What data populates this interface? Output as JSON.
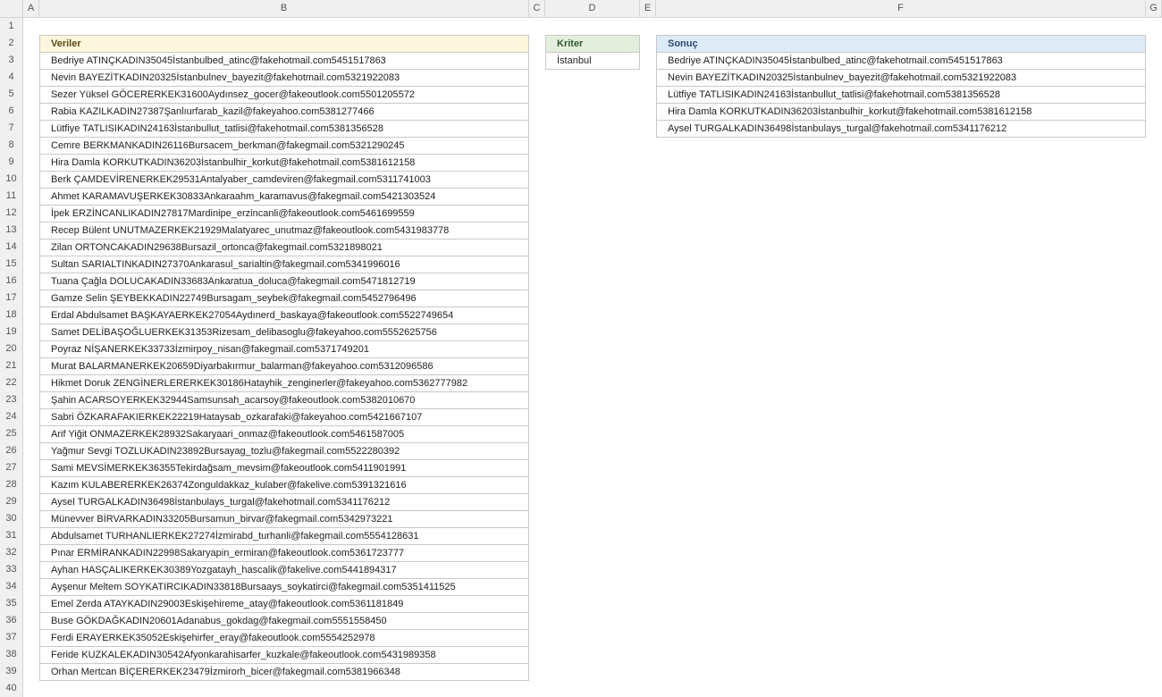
{
  "columns": [
    "A",
    "B",
    "C",
    "D",
    "E",
    "F",
    "G"
  ],
  "rows": [
    "1",
    "2",
    "3",
    "4",
    "5",
    "6",
    "7",
    "8",
    "9",
    "10",
    "11",
    "12",
    "13",
    "14",
    "15",
    "16",
    "17",
    "18",
    "19",
    "20",
    "21",
    "22",
    "23",
    "24",
    "25",
    "26",
    "27",
    "28",
    "29",
    "30",
    "31",
    "32",
    "33",
    "34",
    "35",
    "36",
    "37",
    "38",
    "39",
    "40"
  ],
  "veriler": {
    "header": "Veriler",
    "items": [
      "Bedriye ATINÇKADIN35045İstanbulbed_atinc@fakehotmail.com5451517863",
      "Nevin BAYEZİTKADIN20325İstanbulnev_bayezit@fakehotmail.com5321922083",
      "Sezer Yüksel GÖCERERKEK31600Aydınsez_gocer@fakeoutlook.com5501205572",
      "Rabia KAZILKADIN27387Şanlıurfarab_kazil@fakeyahoo.com5381277466",
      "Lütfiye TATLISIKADIN24163İstanbullut_tatlisi@fakehotmail.com5381356528",
      "Cemre BERKMANKADIN26116Bursacem_berkman@fakegmail.com5321290245",
      "Hira Damla KORKUTKADIN36203İstanbulhir_korkut@fakehotmail.com5381612158",
      "Berk ÇAMDEVİRENERKEK29531Antalyaber_camdeviren@fakegmail.com5311741003",
      "Ahmet KARAMAVUŞERKEK30833Ankaraahm_karamavus@fakegmail.com5421303524",
      "İpek ERZİNCANLIKADIN27817Mardinipe_erzincanli@fakeoutlook.com5461699559",
      "Recep Bülent UNUTMAZERKEK21929Malatyarec_unutmaz@fakeoutlook.com5431983778",
      "Zilan ORTONCAKADIN29638Bursazil_ortonca@fakegmail.com5321898021",
      "Sultan SARIALTINKADIN27370Ankarasul_sarialtin@fakegmail.com5341996016",
      "Tuana Çağla DOLUCAKADIN33683Ankaratua_doluca@fakegmail.com5471812719",
      "Gamze Selin ŞEYBEKKADIN22749Bursagam_seybek@fakegmail.com5452796496",
      "Erdal Abdulsamet BAŞKAYAERKEK27054Aydınerd_baskaya@fakeoutlook.com5522749654",
      "Samet DELİBAŞOĞLUERKEK31353Rizesam_delibasoglu@fakeyahoo.com5552625756",
      "Poyraz NİŞANERKEK33733İzmirpoy_nisan@fakegmail.com5371749201",
      "Murat BALARMANERKEK20659Diyarbakırmur_balarman@fakeyahoo.com5312096586",
      "Hikmet Doruk ZENGİNERLERERKEK30186Hatayhik_zenginerler@fakeyahoo.com5362777982",
      "Şahin ACARSOYERKEK32944Samsunsah_acarsoy@fakeoutlook.com5382010670",
      "Sabri ÖZKARAFAKIERKEK22219Hataysab_ozkarafaki@fakeyahoo.com5421667107",
      "Arif Yiğit ONMAZERKEK28932Sakaryaari_onmaz@fakeoutlook.com5461587005",
      "Yağmur Sevgi TOZLUKADIN23892Bursayag_tozlu@fakegmail.com5522280392",
      "Sami MEVSİMERKEK36355Tekirdağsam_mevsim@fakeoutlook.com5411901991",
      "Kazım KULABERERKEK26374Zonguldakkaz_kulaber@fakelive.com5391321616",
      "Aysel TURGALKADIN36498İstanbulays_turgal@fakehotmail.com5341176212",
      "Münevver BİRVARKADIN33205Bursamun_birvar@fakegmail.com5342973221",
      "Abdulsamet TURHANLIERKEK27274İzmirabd_turhanli@fakegmail.com5554128631",
      "Pınar ERMİRANKADIN22998Sakaryapin_ermiran@fakeoutlook.com5361723777",
      "Ayhan HASÇALIKERKEK30389Yozgatayh_hascalik@fakelive.com5441894317",
      "Ayşenur Meltem SOYKATIRCIKADIN33818Bursaays_soykatirci@fakegmail.com5351411525",
      "Emel Zerda ATAYKADIN29003Eskişehireme_atay@fakeoutlook.com5361181849",
      "Buse GÖKDAĞKADIN20601Adanabus_gokdag@fakegmail.com5551558450",
      "Ferdi ERAYERKEK35052Eskişehirfer_eray@fakeoutlook.com5554252978",
      "Feride KUZKALEKADIN30542Afyonkarahisarfer_kuzkale@fakeoutlook.com5431989358",
      "Orhan Mertcan BİÇERERKEK23479İzmirorh_bicer@fakegmail.com5381966348"
    ]
  },
  "kriter": {
    "header": "Kriter",
    "value": "İstanbul"
  },
  "sonuc": {
    "header": "Sonuç",
    "items": [
      "Bedriye ATINÇKADIN35045İstanbulbed_atinc@fakehotmail.com5451517863",
      "Nevin BAYEZİTKADIN20325İstanbulnev_bayezit@fakehotmail.com5321922083",
      "Lütfiye TATLISIKADIN24163İstanbullut_tatlisi@fakehotmail.com5381356528",
      "Hira Damla KORKUTKADIN36203İstanbulhir_korkut@fakehotmail.com5381612158",
      "Aysel TURGALKADIN36498İstanbulays_turgal@fakehotmail.com5341176212"
    ]
  },
  "colors": {
    "veriler_header": "#fdf6dc",
    "kriter_header": "#e3efdc",
    "sonuc_header": "#ddebf7"
  }
}
